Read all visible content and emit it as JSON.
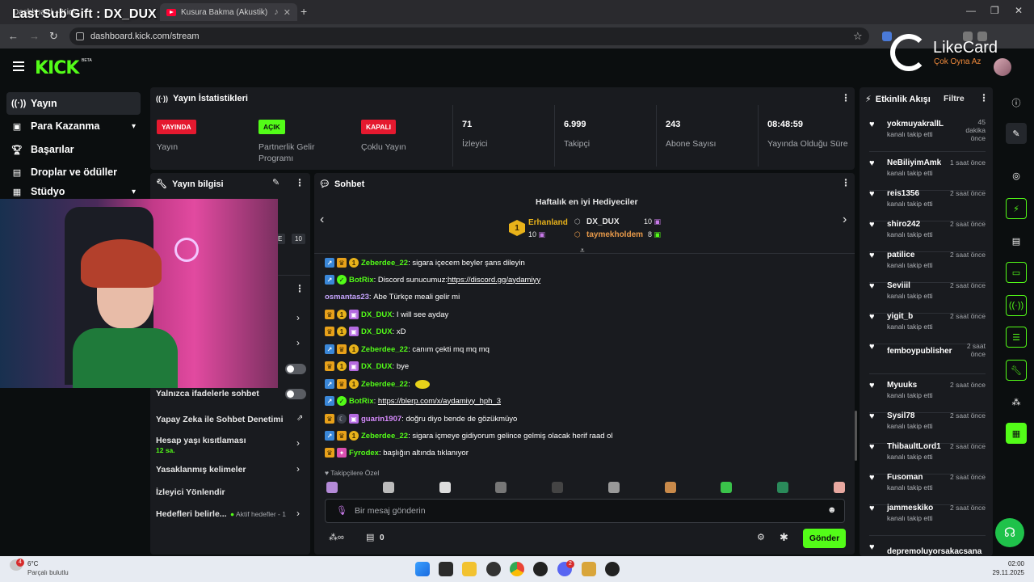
{
  "overlay": {
    "last_sub_gift": "Last Sub Gift : DX_DUX"
  },
  "browser": {
    "tab1_title": "Dashboard – Kick",
    "tab2_title": "Kusura Bakma (Akustik) - Berk",
    "url": "dashboard.kick.com/stream"
  },
  "brand": {
    "logo": "KICK",
    "beta": "BETA",
    "likecard": "LikeCard",
    "likecard_sub": "Çok Oyna   Az"
  },
  "sidebar": {
    "items": [
      {
        "label": "Yayın",
        "icon": "broadcast-icon"
      },
      {
        "label": "Para Kazanma",
        "icon": "money-icon"
      },
      {
        "label": "Başarılar",
        "icon": "trophy-icon"
      },
      {
        "label": "Droplar ve ödüller",
        "icon": "drops-icon"
      },
      {
        "label": "Stüdyo",
        "icon": "studio-icon"
      }
    ]
  },
  "stats": {
    "title": "Yayın İstatistikleri",
    "items": [
      {
        "badge": "YAYINDA",
        "label": "Yayın"
      },
      {
        "badge": "AÇIK",
        "label": "Partnerlik Gelir Programı"
      },
      {
        "badge": "KAPALI",
        "label": "Çoklu Yayın"
      },
      {
        "value": "71",
        "label": "İzleyici"
      },
      {
        "value": "6.999",
        "label": "Takipçi"
      },
      {
        "value": "243",
        "label": "Abone Sayısı"
      },
      {
        "value": "08:48:59",
        "label": "Yayında Olduğu Süre"
      }
    ]
  },
  "stream_info": {
    "title": "Yayın bilgisi",
    "tag_e": "E",
    "tag_10": "10"
  },
  "settings": {
    "emote_only": "Yalnızca ifadelerle sohbet",
    "ai_moderation": "Yapay Zeka ile Sohbet Denetimi",
    "age_limit": "Hesap yaşı kısıtlaması",
    "age_limit_value": "12 sa.",
    "banned_words": "Yasaklanmış kelimeler",
    "redirect": "İzleyici Yönlendir",
    "goals": "Hedefleri belirle...",
    "goals_status": "Aktif hedefler - 1"
  },
  "chat": {
    "title": "Sohbet",
    "gifters_title": "Haftalık en iyi Hediyeciler",
    "gifters": [
      {
        "name": "Erhanland",
        "count": "10"
      },
      {
        "name": "DX_DUX",
        "count": "10"
      },
      {
        "name": "taymekholdem",
        "count": "8"
      }
    ],
    "messages": [
      {
        "user": "Zeberdee_22",
        "text": "sigara içecem beyler şans dileyin"
      },
      {
        "user": "BotRix",
        "text": "Discord sunucumuz: ",
        "link": "https://discord.gg/aydamiyy"
      },
      {
        "user": "osmantas23",
        "text": "Abe Türkçe meali gelir mi"
      },
      {
        "user": "DX_DUX",
        "text": "I will see ayday"
      },
      {
        "user": "DX_DUX",
        "text": "xD"
      },
      {
        "user": "Zeberdee_22",
        "text": "canım çekti mq mq mq"
      },
      {
        "user": "DX_DUX",
        "text": "bye"
      },
      {
        "user": "Zeberdee_22",
        "text": ""
      },
      {
        "user": "BotRix",
        "text": "",
        "link": "https://blerp.com/x/aydamiyy_hph_3"
      },
      {
        "user": "guarin1907",
        "text": "doğru diyo bende de gözükmüyo"
      },
      {
        "user": "Zeberdee_22",
        "text": "sigara içmeye gidiyorum gelince gelmiş olacak herif raad ol"
      },
      {
        "user": "Fyrodex",
        "text": "başlığın altında tıklanıyor"
      }
    ],
    "followers_only": "Takipçilere Özel",
    "input_placeholder": "Bir mesaj gönderin",
    "points": "0",
    "send": "Gönder"
  },
  "activity": {
    "title": "Etkinlik Akışı",
    "filter": "Filtre",
    "events": [
      {
        "user": "yokmuyakrallL",
        "sub": "kanalı takip etti",
        "time": "45 dakika önce"
      },
      {
        "user": "NeBiliyimAmk",
        "sub": "kanalı takip etti",
        "time": "1 saat önce"
      },
      {
        "user": "reis1356",
        "sub": "kanalı takip etti",
        "time": "2 saat önce"
      },
      {
        "user": "shiro242",
        "sub": "kanalı takip etti",
        "time": "2 saat önce"
      },
      {
        "user": "patilice",
        "sub": "kanalı takip etti",
        "time": "2 saat önce"
      },
      {
        "user": "Seviiil",
        "sub": "kanalı takip etti",
        "time": "2 saat önce"
      },
      {
        "user": "yigit_b",
        "sub": "kanalı takip etti",
        "time": "2 saat önce"
      },
      {
        "user": "femboypublisher",
        "sub": "",
        "time": "2 saat önce"
      },
      {
        "user": "Myuuks",
        "sub": "kanalı takip etti",
        "time": "2 saat önce"
      },
      {
        "user": "Sysil78",
        "sub": "kanalı takip etti",
        "time": "2 saat önce"
      },
      {
        "user": "ThibaultLord1",
        "sub": "kanalı takip etti",
        "time": "2 saat önce"
      },
      {
        "user": "Fusoman",
        "sub": "kanalı takip etti",
        "time": "2 saat önce"
      },
      {
        "user": "jammeskiko",
        "sub": "kanalı takip etti",
        "time": "2 saat önce"
      },
      {
        "user": "depremoluyorsakacsana",
        "sub": "",
        "time": ""
      }
    ]
  },
  "taskbar": {
    "temp": "6°C",
    "weather": "Parçalı bulutlu",
    "time": "02:00",
    "date": "29.11.2025",
    "badge": "4",
    "discord_badge": "2"
  },
  "colors": {
    "accent": "#53fc18",
    "live": "#e5192f",
    "panel": "#191b1f",
    "bg": "#0b0e0f"
  }
}
